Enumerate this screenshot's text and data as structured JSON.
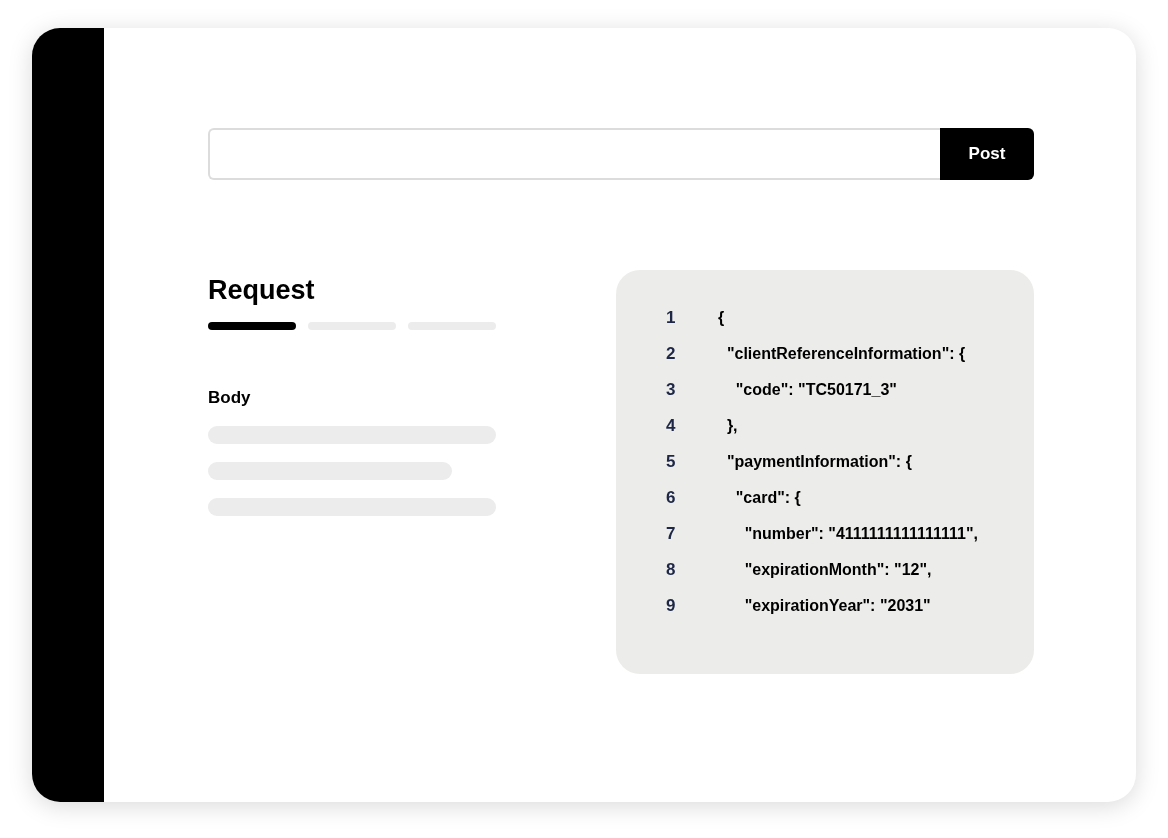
{
  "request_bar": {
    "button": "Post"
  },
  "request": {
    "title": "Request",
    "steps": [
      {
        "selected": true
      },
      {
        "selected": false
      },
      {
        "selected": false
      }
    ],
    "body_label": "Body"
  },
  "code": {
    "lines": [
      {
        "number": "1",
        "text": "{"
      },
      {
        "number": "2",
        "text": "  \"clientReferenceInformation\": {"
      },
      {
        "number": "3",
        "text": "    \"code\": \"TC50171_3\""
      },
      {
        "number": "4",
        "text": "  },"
      },
      {
        "number": "5",
        "text": "  \"paymentInformation\": {"
      },
      {
        "number": "6",
        "text": "    \"card\": {"
      },
      {
        "number": "7",
        "text": "      \"number\": \"4111111111111111\","
      },
      {
        "number": "8",
        "text": "      \"expirationMonth\": \"12\","
      },
      {
        "number": "9",
        "text": "      \"expirationYear\": \"2031\""
      }
    ]
  }
}
